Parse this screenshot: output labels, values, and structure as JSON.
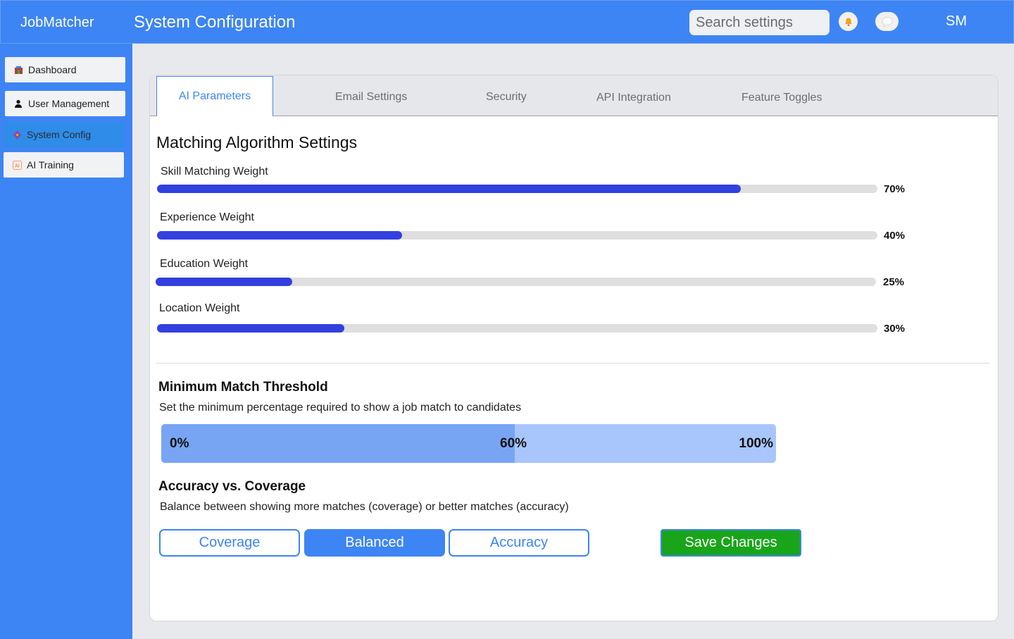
{
  "app": {
    "brand": "JobMatcher",
    "page_title": "System Configuration"
  },
  "header": {
    "search_placeholder": "Search settings",
    "notification_icon": "bell-icon",
    "messages_icon": "chat-icon",
    "avatar_initials": "SM"
  },
  "sidebar": {
    "items": [
      {
        "label": "Dashboard",
        "icon": "dashboard-icon"
      },
      {
        "label": "User Management",
        "icon": "user-icon"
      },
      {
        "label": "System Config",
        "icon": "gear-icon",
        "active": true
      },
      {
        "label": "AI Training",
        "icon": "ai-icon"
      }
    ]
  },
  "tabs": [
    {
      "label": "AI Parameters",
      "active": true
    },
    {
      "label": "Email Settings"
    },
    {
      "label": "Security"
    },
    {
      "label": "API Integration"
    },
    {
      "label": "Feature Toggles"
    }
  ],
  "matching": {
    "title": "Matching Algorithm Settings",
    "weights": [
      {
        "label": "Skill Matching Weight",
        "value_text": "70%",
        "fill_fraction": 0.81
      },
      {
        "label": "Experience Weight",
        "value_text": "40%",
        "fill_fraction": 0.34
      },
      {
        "label": "Education Weight",
        "value_text": "25%",
        "fill_fraction": 0.19
      },
      {
        "label": "Location Weight",
        "value_text": "30%",
        "fill_fraction": 0.26
      }
    ]
  },
  "threshold": {
    "title": "Minimum Match Threshold",
    "description": "Set the minimum percentage required to show a job match to candidates",
    "min_label": "0%",
    "current_label": "60%",
    "max_label": "100%",
    "fill_fraction": 0.575
  },
  "balance": {
    "title": "Accuracy vs. Coverage",
    "description": "Balance between showing more matches (coverage) or better matches (accuracy)",
    "options": [
      "Coverage",
      "Balanced",
      "Accuracy"
    ],
    "selected": "Balanced"
  },
  "actions": {
    "save_label": "Save Changes"
  },
  "colors": {
    "accent": "#3d85f4",
    "bar_fill": "#3340e0",
    "save": "#19a51a"
  }
}
